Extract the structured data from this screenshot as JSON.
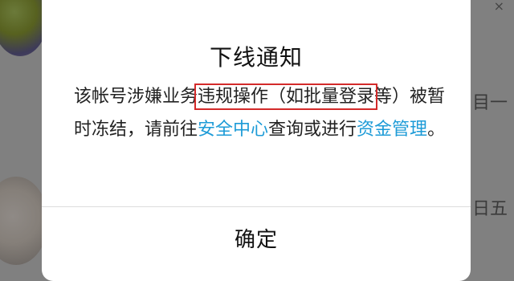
{
  "background": {
    "side_text_1": "目一",
    "side_text_2": "日五",
    "badge": "×"
  },
  "dialog": {
    "title": "下线通知",
    "message": {
      "part1": "该帐号涉嫌业务",
      "highlight": "违规操作（如批量登录",
      "part2": "等）被暂时冻结，请前往",
      "link1": "安全中心",
      "part3": "查询或进行",
      "link2": "资金管理",
      "part4": "。"
    },
    "confirm_label": "确定"
  },
  "colors": {
    "link": "#1d9bd7",
    "highlight_border": "#d32a2a"
  }
}
